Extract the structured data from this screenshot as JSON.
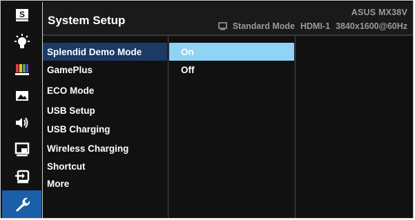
{
  "header": {
    "title": "System Setup",
    "brand_model": "ASUS  MX38V",
    "mode": "Standard Mode",
    "input": "HDMI-1",
    "resolution": "3840x1600@60Hz"
  },
  "sidebar": {
    "items": [
      {
        "name": "splendid",
        "icon": "splendid-s-icon"
      },
      {
        "name": "blue-light-filter",
        "icon": "blue-light-filter-icon"
      },
      {
        "name": "color",
        "icon": "color-bars-icon"
      },
      {
        "name": "image",
        "icon": "image-icon"
      },
      {
        "name": "sound",
        "icon": "speaker-icon"
      },
      {
        "name": "pip-pbp",
        "icon": "pip-icon"
      },
      {
        "name": "input-select",
        "icon": "input-select-icon"
      },
      {
        "name": "system-setup",
        "icon": "wrench-icon",
        "active": true
      }
    ]
  },
  "menu": {
    "items": [
      {
        "label": "Splendid Demo Mode"
      },
      {
        "label": "GamePlus"
      },
      {
        "label": "ECO Mode"
      },
      {
        "label": "USB Setup"
      },
      {
        "label": "USB Charging"
      },
      {
        "label": "Wireless Charging"
      },
      {
        "label": "Shortcut"
      },
      {
        "label": "More"
      }
    ]
  },
  "options": {
    "items": [
      {
        "label": "On"
      },
      {
        "label": "Off"
      }
    ],
    "selected": "On"
  },
  "colors": {
    "frame_bg": "#111111",
    "header_bg": "#1a1a1a",
    "active_tab": "#1b5fa8",
    "menu_highlight": "#1b3a66",
    "option_highlight": "#8fd3f5",
    "text": "#ffffff",
    "status_text": "#9a9a9a"
  }
}
